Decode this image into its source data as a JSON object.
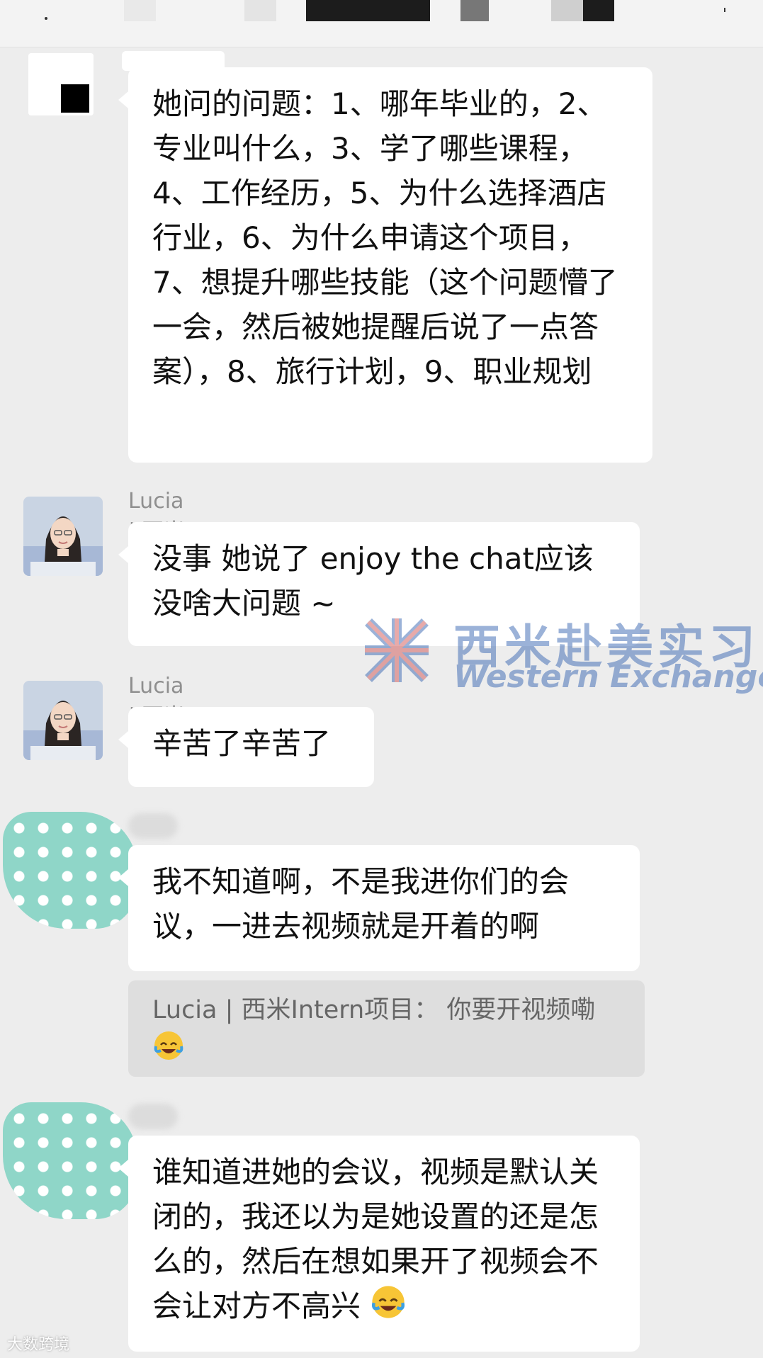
{
  "messages": {
    "m1": {
      "text": "她问的问题：1、哪年毕业的，2、专业叫什么，3、学了哪些课程，4、工作经历，5、为什么选择酒店行业，6、为什么申请这个项目，7、想提升哪些技能（这个问题懵了一会，然后被她提醒后说了一点答案），8、旅行计划，9、职业规划"
    },
    "m2": {
      "sender": "Lucia | 西米Intern项目",
      "text": "没事 她说了 enjoy the chat应该没啥大问题 ~"
    },
    "m3": {
      "sender": "Lucia | 西米Intern项目",
      "text": "辛苦了辛苦了"
    },
    "m4": {
      "text": "我不知道啊，不是我进你们的会议，一进去视频就是开着的啊",
      "quote": "Lucia | 西米Intern项目： 你要开视频嘞"
    },
    "m5": {
      "text": "谁知道进她的会议，视频是默认关闭的，我还以为是她设置的还是怎么的，然后在想如果开了视频会不会让对方不高兴"
    }
  },
  "watermark": {
    "cn": "西米赴美实习",
    "en": "Western Exchange"
  },
  "footer": "大数跨境",
  "icons": [
    "facepalm-emoji",
    "union-jack-logo",
    "avatar-lucia",
    "dotted-avatar"
  ],
  "colors": {
    "background": "#ededed",
    "bubble": "#ffffff",
    "quote": "#dedede",
    "watermark": "#3a68b3",
    "dotted_avatar": "#8fd6c8"
  }
}
